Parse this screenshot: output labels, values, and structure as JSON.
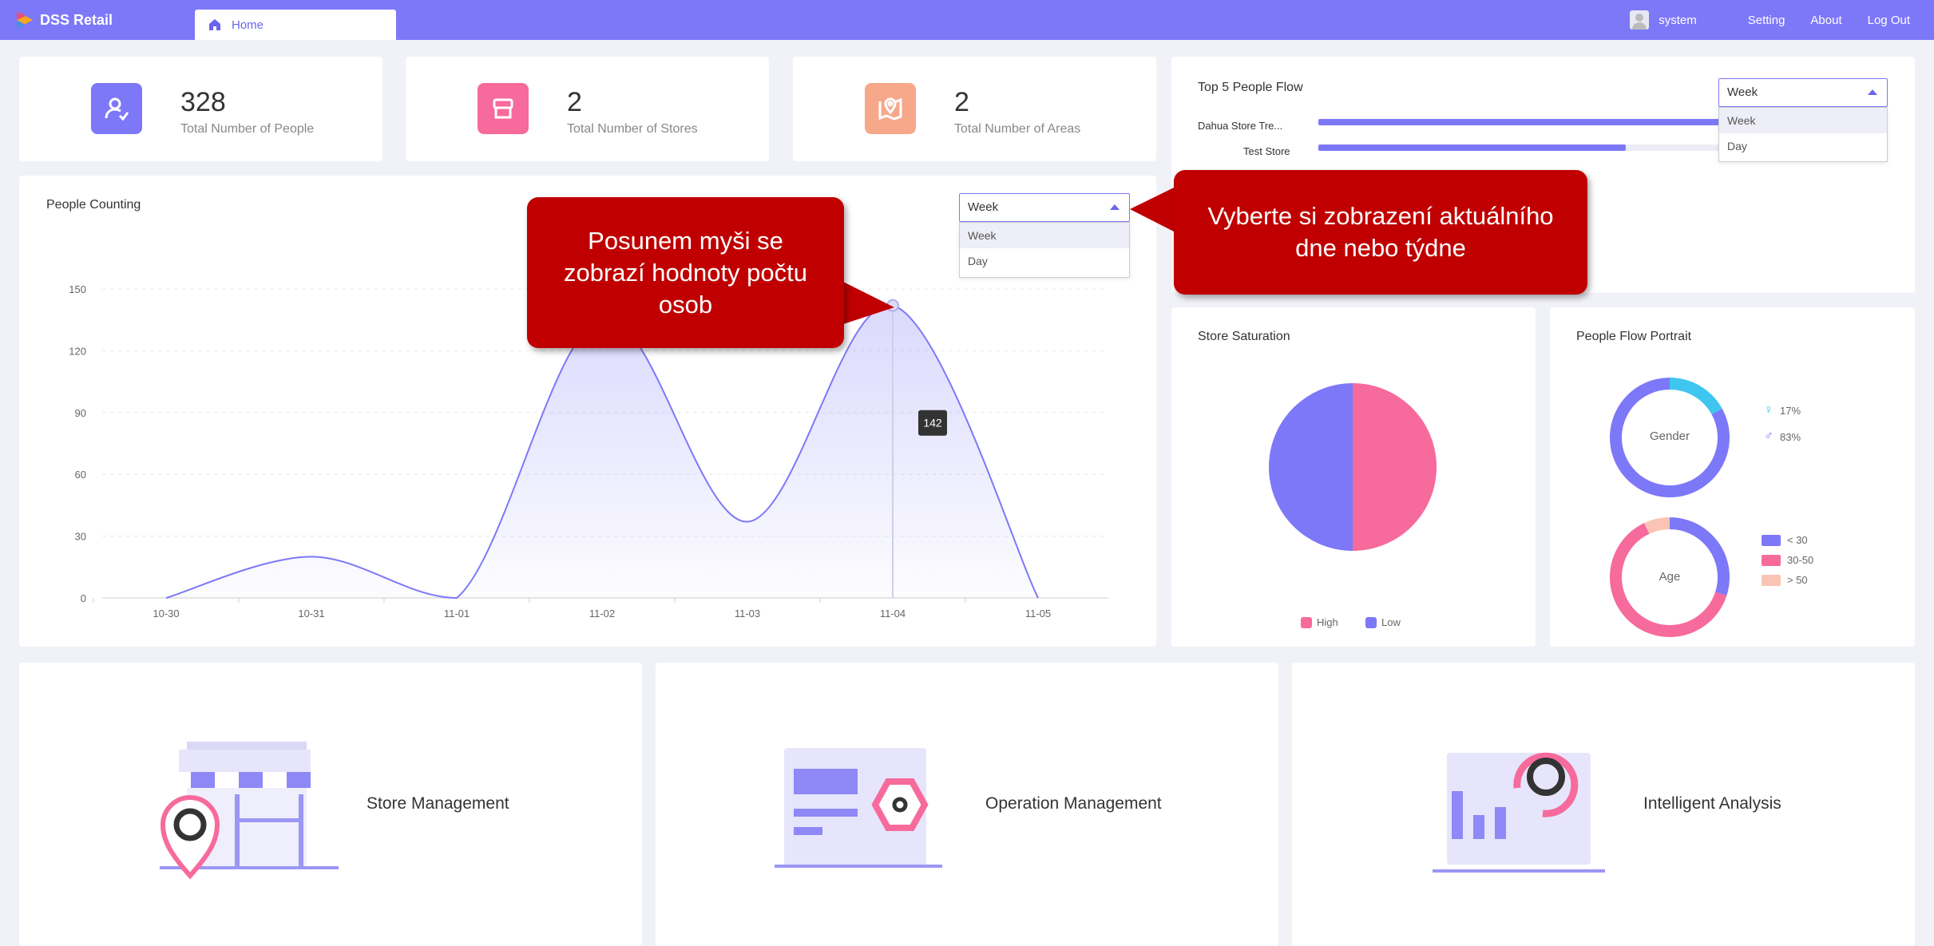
{
  "app": {
    "name": "DSS Retail"
  },
  "tabs": [
    {
      "label": "Home"
    }
  ],
  "header": {
    "username": "system",
    "nav": [
      "Setting",
      "About",
      "Log Out"
    ]
  },
  "stats": [
    {
      "value": "328",
      "label": "Total Number of People",
      "icon": "person-check-icon",
      "color": "#7d78f8"
    },
    {
      "value": "2",
      "label": "Total Number of Stores",
      "icon": "store-icon",
      "color": "#f76a9c"
    },
    {
      "value": "2",
      "label": "Total Number of Areas",
      "icon": "map-pin-icon",
      "color": "#f7a88a"
    }
  ],
  "top5": {
    "title": "Top 5 People Flow",
    "dropdown": {
      "selected": "Week",
      "options": [
        "Week",
        "Day"
      ]
    },
    "rows": [
      {
        "name": "Dahua Store Tre...",
        "share": 1.0
      },
      {
        "name": "Test Store",
        "share": 0.55
      }
    ]
  },
  "people_counting": {
    "title": "People Counting",
    "dropdown": {
      "selected": "Week",
      "options": [
        "Week",
        "Day"
      ]
    },
    "tooltip_value": "142"
  },
  "chart_data": [
    {
      "type": "area",
      "title": "People Counting",
      "x": [
        "10-30",
        "10-31",
        "11-01",
        "11-02",
        "11-03",
        "11-04",
        "11-05"
      ],
      "values": [
        0,
        20,
        0,
        136,
        37,
        142,
        0
      ],
      "ylim": [
        0,
        150
      ],
      "yticks": [
        0,
        30,
        60,
        90,
        120,
        150
      ],
      "grid": true,
      "color": "#7d78f8"
    },
    {
      "type": "pie",
      "title": "Store Saturation",
      "labels": [
        "High",
        "Low"
      ],
      "values": [
        50,
        50
      ],
      "colors": [
        "#f76a9c",
        "#7d78f8"
      ],
      "legend": "bottom"
    },
    {
      "type": "pie",
      "title": "Gender",
      "labels": [
        "female",
        "male"
      ],
      "values": [
        17,
        83
      ],
      "colors": [
        "#3ec6ee",
        "#7d78f8"
      ],
      "legend": "right"
    },
    {
      "type": "pie",
      "title": "Age",
      "labels": [
        "< 30",
        "30-50",
        "> 50"
      ],
      "values": [
        30,
        63,
        7
      ],
      "colors": [
        "#7d78f8",
        "#f76a9c",
        "#f9c4b4"
      ],
      "legend": "right"
    }
  ],
  "store_saturation": {
    "title": "Store Saturation",
    "legend": [
      "High",
      "Low"
    ]
  },
  "portrait": {
    "title": "People Flow Portrait",
    "gender_label": "Gender",
    "female_pct": "17%",
    "male_pct": "83%",
    "age_label": "Age",
    "age_legend": [
      "< 30",
      "30-50",
      "> 50"
    ]
  },
  "callouts": [
    {
      "text": "Posunem myši se zobrazí hodnoty počtu osob"
    },
    {
      "text": "Vyberte si zobrazení aktuálního dne nebo týdne"
    }
  ],
  "management": [
    {
      "label": "Store Management",
      "icon": "store-management-icon"
    },
    {
      "label": "Operation Management",
      "icon": "operation-management-icon"
    },
    {
      "label": "Intelligent Analysis",
      "icon": "intelligent-analysis-icon"
    }
  ]
}
